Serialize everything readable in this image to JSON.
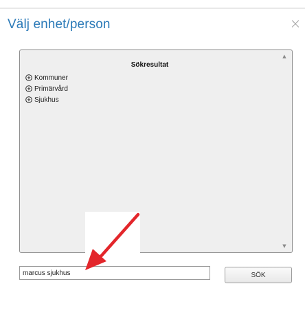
{
  "dialog": {
    "title": "Välj enhet/person",
    "close_label": "×"
  },
  "results": {
    "heading": "Sökresultat",
    "items": [
      {
        "label": "Kommuner",
        "icon": "plus-circle-icon"
      },
      {
        "label": "Primärvård",
        "icon": "plus-circle-icon"
      },
      {
        "label": "Sjukhus",
        "icon": "plus-circle-icon"
      }
    ],
    "scroll_up": "▲",
    "scroll_down": "▼"
  },
  "search": {
    "value": "marcus sjukhus",
    "button_label": "SÖK"
  },
  "colors": {
    "title": "#2b7ab8",
    "annotation_arrow": "#e3262b",
    "panel_bg": "#efefef"
  }
}
